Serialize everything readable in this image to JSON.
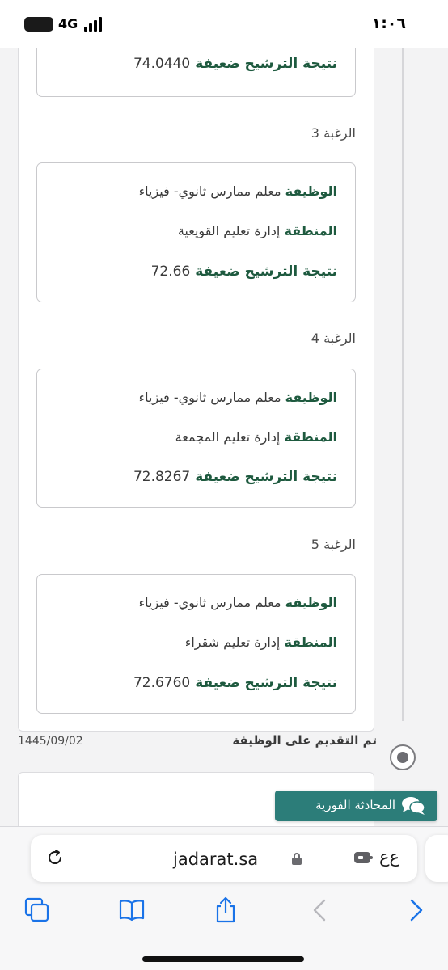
{
  "status_bar": {
    "time": "١:٠٦",
    "network": "4G",
    "battery_label": ""
  },
  "top_card": {
    "result_label": "نتيجة الترشيح ضعيفة",
    "result_value": "74.0440"
  },
  "wishes": [
    {
      "title": "الرغبة 3",
      "job_label": "الوظيفة",
      "job_value": "معلم ممارس ثانوي- فيزياء",
      "region_label": "المنطقة",
      "region_value": "إدارة تعليم القويعية",
      "result_label": "نتيجة الترشيح ضعيفة",
      "result_value": "72.66"
    },
    {
      "title": "الرغبة 4",
      "job_label": "الوظيفة",
      "job_value": "معلم ممارس ثانوي- فيزياء",
      "region_label": "المنطقة",
      "region_value": "إدارة تعليم المجمعة",
      "result_label": "نتيجة الترشيح ضعيفة",
      "result_value": "72.8267"
    },
    {
      "title": "الرغبة 5",
      "job_label": "الوظيفة",
      "job_value": "معلم ممارس ثانوي- فيزياء",
      "region_label": "المنطقة",
      "region_value": "إدارة تعليم شقراء",
      "result_label": "نتيجة الترشيح ضعيفة",
      "result_value": "72.6760"
    }
  ],
  "timeline": {
    "submitted_label": "تم التقديم على الوظيفة",
    "submitted_date": "1445/09/02"
  },
  "chat_button": {
    "label": "المحادثة الفورية"
  },
  "browser": {
    "url": "jadarat.sa",
    "aa_label": "ع‌ع"
  },
  "colors": {
    "accent_green": "#1e5a3f",
    "chat_teal": "#2c7d79",
    "link_blue": "#1a73e8"
  }
}
